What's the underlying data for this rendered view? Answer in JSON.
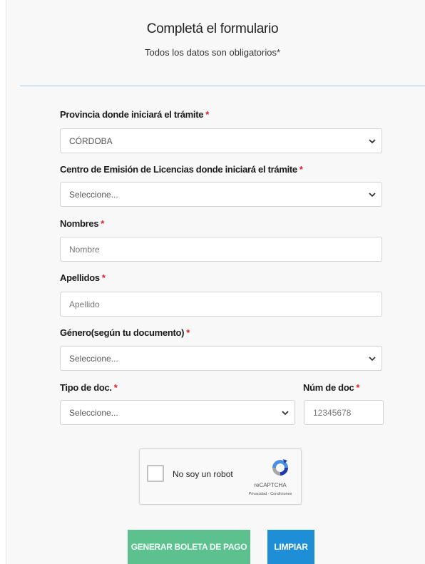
{
  "form": {
    "title": "Completá el formulario",
    "subtitle": "Todos los datos son obligatorios*",
    "required_mark": "*",
    "provincia": {
      "label": "Provincia donde iniciará el trámite",
      "value": "CÓRDOBA"
    },
    "centro": {
      "label": "Centro de Emisión de Licencias donde iniciará el trámite",
      "value": "Seleccione..."
    },
    "nombres": {
      "label": "Nombres",
      "placeholder": "Nombre"
    },
    "apellidos": {
      "label": "Apellidos",
      "placeholder": "Apellido"
    },
    "genero": {
      "label": "Género(según tu documento)",
      "value": "Seleccione..."
    },
    "tipo_doc": {
      "label": "Tipo de doc.",
      "value": "Seleccione..."
    },
    "num_doc": {
      "label": "Núm de doc",
      "placeholder": "12345678"
    }
  },
  "captcha": {
    "text": "No soy un robot",
    "brand": "reCAPTCHA",
    "links": "Privacidad - Condiciones"
  },
  "buttons": {
    "generate": "GENERAR BOLETA DE PAGO",
    "clear": "LIMPIAR"
  },
  "colors": {
    "required": "#d9222a",
    "generate_button": "#5cc08f",
    "clear_button": "#1e8fd6",
    "divider": "#a9c7dc"
  }
}
